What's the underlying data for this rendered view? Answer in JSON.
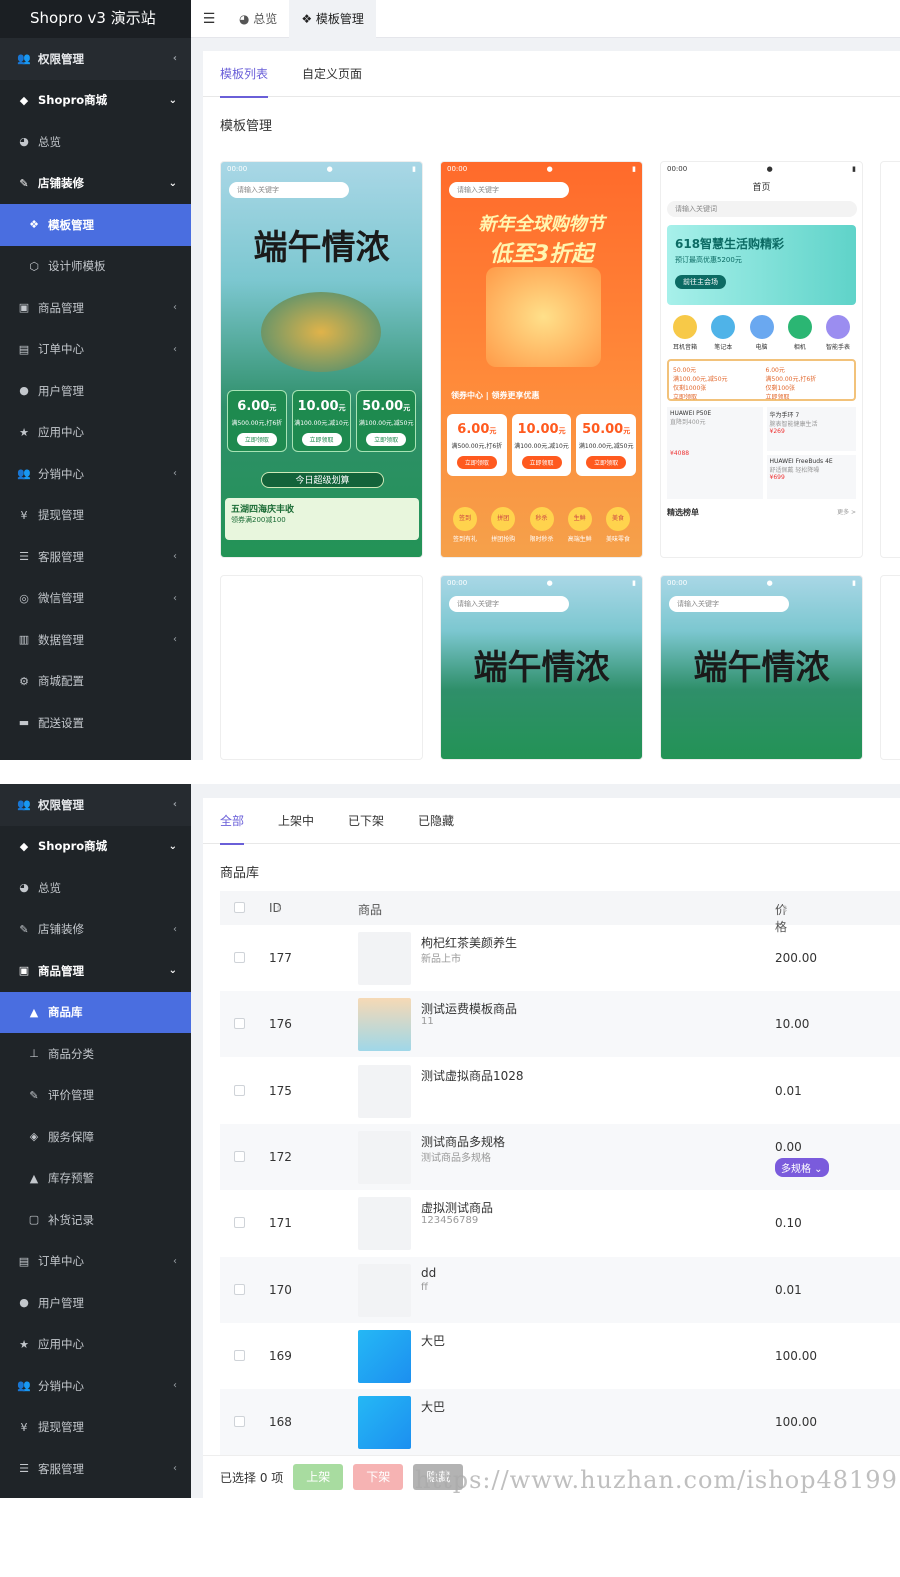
{
  "app_title": "Shopro v3 演示站",
  "screen1": {
    "menu": [
      {
        "label": "权限管理",
        "icon": "users-icon",
        "arrow": "‹",
        "style": "top"
      },
      {
        "label": "Shopro商城",
        "icon": "diamond-icon",
        "arrow": "⌄",
        "style": "open"
      },
      {
        "label": "总览",
        "icon": "pie-icon",
        "arrow": "",
        "style": "sub"
      },
      {
        "label": "店铺装修",
        "icon": "brush-icon",
        "arrow": "⌄",
        "style": "open"
      },
      {
        "label": "模板管理",
        "icon": "cubes-icon",
        "arrow": "",
        "style": "active"
      },
      {
        "label": "设计师模板",
        "icon": "cube-icon",
        "arrow": "",
        "style": "sub2"
      },
      {
        "label": "商品管理",
        "icon": "box-icon",
        "arrow": "‹",
        "style": "sub"
      },
      {
        "label": "订单中心",
        "icon": "file-icon",
        "arrow": "‹",
        "style": "sub"
      },
      {
        "label": "用户管理",
        "icon": "user-icon",
        "arrow": "",
        "style": "sub"
      },
      {
        "label": "应用中心",
        "icon": "star-icon",
        "arrow": "",
        "style": "sub"
      },
      {
        "label": "分销中心",
        "icon": "users-icon",
        "arrow": "‹",
        "style": "sub"
      },
      {
        "label": "提现管理",
        "icon": "yen-icon",
        "arrow": "",
        "style": "sub"
      },
      {
        "label": "客服管理",
        "icon": "list-icon",
        "arrow": "‹",
        "style": "sub"
      },
      {
        "label": "微信管理",
        "icon": "wechat-icon",
        "arrow": "‹",
        "style": "sub"
      },
      {
        "label": "数据管理",
        "icon": "chart-icon",
        "arrow": "‹",
        "style": "sub"
      },
      {
        "label": "商城配置",
        "icon": "gears-icon",
        "arrow": "",
        "style": "sub"
      },
      {
        "label": "配送设置",
        "icon": "car-icon",
        "arrow": "",
        "style": "sub"
      }
    ],
    "top_tabs": [
      {
        "label": "总览",
        "icon": "pie-icon"
      },
      {
        "label": "模板管理",
        "icon": "cubes-icon"
      }
    ],
    "tabs": [
      "模板列表",
      "自定义页面"
    ],
    "section_title": "模板管理",
    "templates": {
      "status_time": "00:00",
      "search_placeholder": "请输入关键字",
      "search_placeholder_alt": "请输入关键词",
      "green_title": "端午情浓",
      "orange_title_1": "新年全球购物节",
      "orange_title_2": "低至3折起",
      "orange_coupon_header": "领券中心 | 领券更享优惠",
      "white_header": "首页",
      "white_banner": "618智慧生活购精彩",
      "white_banner_sub": "预订最高优惠5200元",
      "white_banner_btn": "前往主会场",
      "today_deal": "今日超级划算",
      "promo": "五湖四海庆丰收",
      "promo_sub": "领券满200减100",
      "pick_title": "精选榜单",
      "pick_more": "更多 >",
      "coupons": [
        {
          "amount": "6.00",
          "unit": "元",
          "cond": "满500.00元,打6折",
          "btn": "立即领取"
        },
        {
          "amount": "10.00",
          "unit": "元",
          "cond": "满100.00元,减10元",
          "btn": "立即领取"
        },
        {
          "amount": "50.00",
          "unit": "元",
          "cond": "满100.00元,减50元",
          "btn": "立即领取"
        }
      ],
      "orange_icons": [
        "签到有礼",
        "拼团抢购",
        "限时秒杀",
        "高端生鲜",
        "美味零食"
      ],
      "orange_icon_tags": [
        "签到",
        "拼团",
        "秒杀",
        "生鲜",
        "美食"
      ],
      "white_icons": [
        "耳机音箱",
        "笔记本",
        "电脑",
        "相机",
        "智能手表"
      ],
      "white_cards": [
        {
          "title": "HUAWEI P50E",
          "sub": "直降到400元",
          "price": "¥4088"
        },
        {
          "title": "华为手环 7",
          "sub": "腕表智能健康生活",
          "price": "¥269"
        },
        {
          "title": "HUAWEI FreeBuds 4E",
          "sub": "舒适佩戴 轻松降噪",
          "price": "¥699"
        }
      ],
      "white_coupons": [
        {
          "amount": "50.00元",
          "cond": "满100.00元,减50元",
          "extra": "仅剩1000张",
          "btn": "立即领取"
        },
        {
          "amount": "6.00元",
          "cond": "满500.00元,打6折",
          "extra": "仅剩100张",
          "btn": "立即领取"
        }
      ]
    }
  },
  "screen2": {
    "menu": [
      {
        "label": "权限管理",
        "icon": "users-icon",
        "arrow": "‹",
        "style": "top"
      },
      {
        "label": "Shopro商城",
        "icon": "diamond-icon",
        "arrow": "⌄",
        "style": "open"
      },
      {
        "label": "总览",
        "icon": "pie-icon",
        "arrow": "",
        "style": "sub"
      },
      {
        "label": "店铺装修",
        "icon": "brush-icon",
        "arrow": "‹",
        "style": "sub"
      },
      {
        "label": "商品管理",
        "icon": "box-icon",
        "arrow": "⌄",
        "style": "open"
      },
      {
        "label": "商品库",
        "icon": "bag-icon",
        "arrow": "",
        "style": "active"
      },
      {
        "label": "商品分类",
        "icon": "sitemap-icon",
        "arrow": "",
        "style": "sub2"
      },
      {
        "label": "评价管理",
        "icon": "edit-icon",
        "arrow": "",
        "style": "sub2"
      },
      {
        "label": "服务保障",
        "icon": "tag-icon",
        "arrow": "",
        "style": "sub2"
      },
      {
        "label": "库存预警",
        "icon": "warning-icon",
        "arrow": "",
        "style": "sub2"
      },
      {
        "label": "补货记录",
        "icon": "note-icon",
        "arrow": "",
        "style": "sub2"
      },
      {
        "label": "订单中心",
        "icon": "file-icon",
        "arrow": "‹",
        "style": "sub"
      },
      {
        "label": "用户管理",
        "icon": "user-icon",
        "arrow": "",
        "style": "sub"
      },
      {
        "label": "应用中心",
        "icon": "star-icon",
        "arrow": "",
        "style": "sub"
      },
      {
        "label": "分销中心",
        "icon": "users-icon",
        "arrow": "‹",
        "style": "sub"
      },
      {
        "label": "提现管理",
        "icon": "yen-icon",
        "arrow": "",
        "style": "sub"
      },
      {
        "label": "客服管理",
        "icon": "list-icon",
        "arrow": "‹",
        "style": "sub"
      }
    ],
    "tabs": [
      "全部",
      "上架中",
      "已下架",
      "已隐藏"
    ],
    "section_title": "商品库",
    "columns": {
      "id": "ID",
      "product": "商品",
      "price": "价格"
    },
    "rows": [
      {
        "id": "177",
        "name": "枸杞红茶美颜养生",
        "sub": "新品上市",
        "price": "200.00",
        "thumb": "blank",
        "badge": ""
      },
      {
        "id": "176",
        "name": "测试运费模板商品",
        "sub": "11",
        "price": "10.00",
        "thumb": "img",
        "badge": ""
      },
      {
        "id": "175",
        "name": "测试虚拟商品1028",
        "sub": "",
        "price": "0.01",
        "thumb": "blank",
        "badge": ""
      },
      {
        "id": "172",
        "name": "测试商品多规格",
        "sub": "测试商品多规格",
        "price": "0.00",
        "thumb": "blank",
        "badge": "多规格 ⌄"
      },
      {
        "id": "171",
        "name": "虚拟测试商品",
        "sub": "123456789",
        "price": "0.10",
        "thumb": "blank",
        "badge": ""
      },
      {
        "id": "170",
        "name": "dd",
        "sub": "ff",
        "price": "0.01",
        "thumb": "blank",
        "badge": ""
      },
      {
        "id": "169",
        "name": "大巴",
        "sub": "",
        "price": "100.00",
        "thumb": "blue",
        "badge": ""
      },
      {
        "id": "168",
        "name": "大巴",
        "sub": "",
        "price": "100.00",
        "thumb": "blue",
        "badge": ""
      }
    ],
    "footer": {
      "selected": "已选择 0 项",
      "buttons": [
        {
          "label": "上架",
          "color": "#a8dca0"
        },
        {
          "label": "下架",
          "color": "#f6b3b3"
        },
        {
          "label": "隐藏",
          "color": "#b3b3b3"
        }
      ]
    }
  },
  "watermark": "https://www.huzhan.com/ishop48199",
  "colors": {
    "sidebar": "#1f2428",
    "active": "#4a6ee0",
    "accent": "#6a5fd8"
  }
}
